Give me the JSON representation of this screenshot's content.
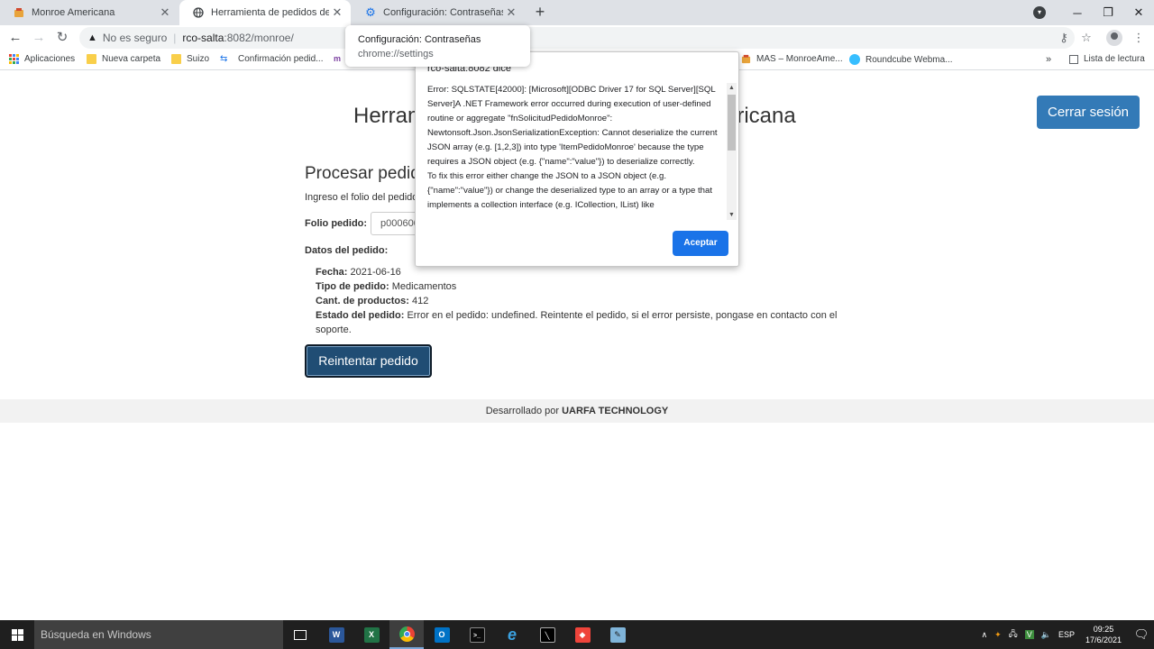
{
  "browser": {
    "tabs": [
      {
        "title": "Monroe Americana",
        "icon": "monroe-favicon"
      },
      {
        "title": "Herramienta de pedidos de Monroe",
        "icon": "globe-icon"
      },
      {
        "title": "Configuración: Contraseñas",
        "icon": "gear-icon"
      }
    ],
    "address": {
      "security": "No es seguro",
      "host": "rco-salta",
      "path": ":8082/monroe/"
    },
    "bookmarks": [
      {
        "label": "Aplicaciones",
        "icon": "apps-grid-icon"
      },
      {
        "label": "Nueva carpeta",
        "icon": "folder-icon"
      },
      {
        "label": "Suizo",
        "icon": "folder-icon"
      },
      {
        "label": "Confirmación pedid...",
        "icon": "link-icon"
      },
      {
        "label": "MAS – MonroeAme...",
        "icon": "monroe-favicon"
      },
      {
        "label": "Roundcube Webma...",
        "icon": "roundcube-icon"
      }
    ],
    "reading_list": "Lista de lectura",
    "hover_card": {
      "title": "Configuración: Contraseñas",
      "url": "chrome://settings"
    }
  },
  "page": {
    "logout_label": "Cerrar sesión",
    "title_left": "Herram",
    "title_right": "ericana",
    "heading": "Procesar pedid",
    "intro": "Ingreso el folio del pedido",
    "folio_label": "Folio pedido:",
    "folio_value": "p000600",
    "datos_label": "Datos del pedido:",
    "details": [
      {
        "label": "Fecha:",
        "value": "2021-06-16"
      },
      {
        "label": "Tipo de pedido:",
        "value": "Medicamentos"
      },
      {
        "label": "Cant. de productos:",
        "value": "412"
      },
      {
        "label": "Estado del pedido:",
        "value": "Error en el pedido: undefined. Reintente el pedido, si el error persiste, pongase en contacto con el soporte."
      }
    ],
    "retry_label": "Reintentar pedido",
    "footer_prefix": "Desarrollado por",
    "footer_company": "UARFA TECHNOLOGY"
  },
  "dialog": {
    "title": "rco-salta:8082 dice",
    "message_1": "Error: SQLSTATE[42000]: [Microsoft][ODBC Driver 17 for SQL Server][SQL Server]A .NET Framework error occurred during execution of user-defined routine or aggregate \"fnSolicitudPedidoMonroe\": Newtonsoft.Json.JsonSerializationException: Cannot deserialize the current JSON array (e.g. [1,2,3]) into type 'ItemPedidoMonroe' because the type requires a JSON object (e.g. {\"name\":\"value\"}) to deserialize correctly.",
    "message_2": "To fix this error either change the JSON to a JSON object (e.g. {\"name\":\"value\"}) or change the deserialized type to an array or a type that implements a collection interface (e.g. ICollection, IList) like",
    "ok_label": "Aceptar"
  },
  "taskbar": {
    "search_placeholder": "Búsqueda en Windows",
    "language": "ESP",
    "time": "09:25",
    "date": "17/6/2021"
  }
}
